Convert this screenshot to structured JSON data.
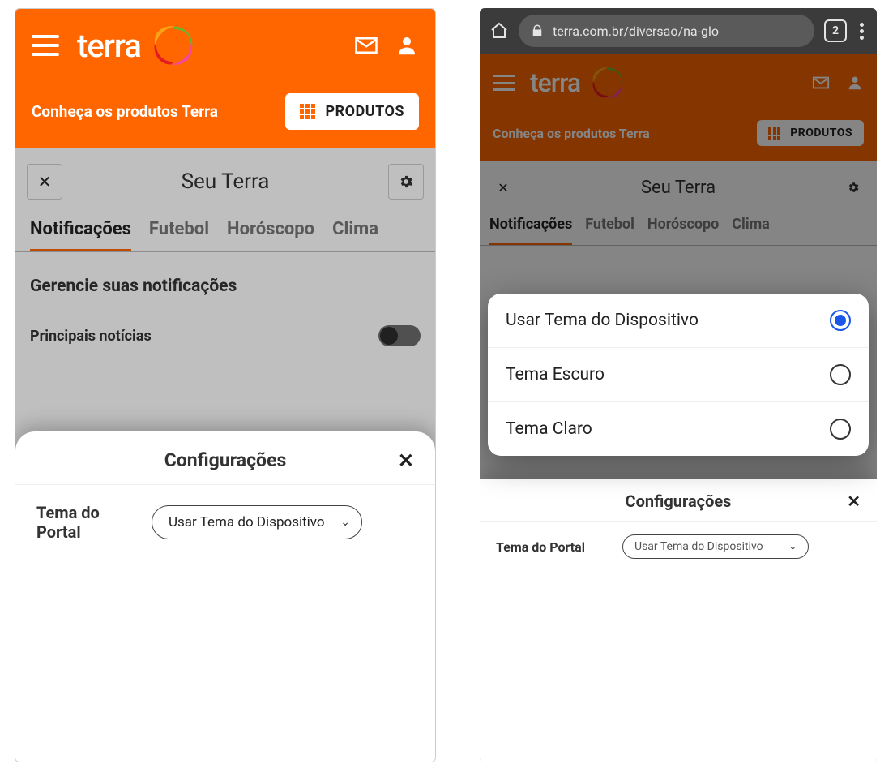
{
  "brand": "terra",
  "subheader_text": "Conheça os produtos Terra",
  "produtos_label": "PRODUTOS",
  "panel_title": "Seu Terra",
  "tabs": [
    "Notificações",
    "Futebol",
    "Horóscopo",
    "Clima"
  ],
  "body_heading": "Gerencie suas notificações",
  "toggle_rows": [
    {
      "label": "Principais notícias"
    }
  ],
  "sheet": {
    "title": "Configurações",
    "field_label": "Tema do Portal",
    "select_value": "Usar Tema do Dispositivo"
  },
  "right": {
    "url": "terra.com.br/diversao/na-glo",
    "tab_count": "2",
    "options": [
      {
        "label": "Usar Tema do Dispositivo",
        "selected": true
      },
      {
        "label": "Tema Escuro",
        "selected": false
      },
      {
        "label": "Tema Claro",
        "selected": false
      }
    ]
  }
}
